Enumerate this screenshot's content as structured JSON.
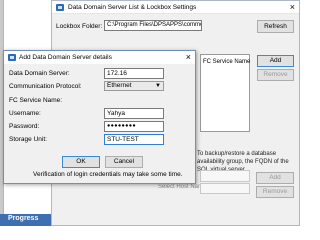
{
  "background": {
    "progress_label": "Progress"
  },
  "settings_window": {
    "title": "Data Domain Server List & Lockbox Settings",
    "close_glyph": "×",
    "lockbox_label": "Lockbox Folder:",
    "lockbox_value": "C:\\Program Files\\DPSAPPS\\common\\lockbox",
    "refresh_label": "Refresh",
    "fc_service_header": "FC Service Name",
    "add_label": "Add",
    "remove_label": "Remove",
    "backup_note": "To backup/restore a database availability group, the FQDN of the SQL virtual server",
    "select_host_label": "Select Host Name:",
    "add2_label": "Add",
    "remove2_label": "Remove"
  },
  "dialog": {
    "title": "Add Data Domain Server details",
    "close_glyph": "×",
    "fields": {
      "server_label": "Data Domain Server:",
      "server_value": "172.16",
      "protocol_label": "Communication Protocol:",
      "protocol_value": "Ethernet",
      "fc_label": "FC Service Name:",
      "username_label": "Username:",
      "username_value": "Yahya",
      "password_label": "Password:",
      "password_value": "●●●●●●●●",
      "storage_label": "Storage Unit:",
      "storage_value": "STU-TEST"
    },
    "ok_label": "OK",
    "cancel_label": "Cancel",
    "verification_note": "Verification of login credentials may take some time."
  }
}
